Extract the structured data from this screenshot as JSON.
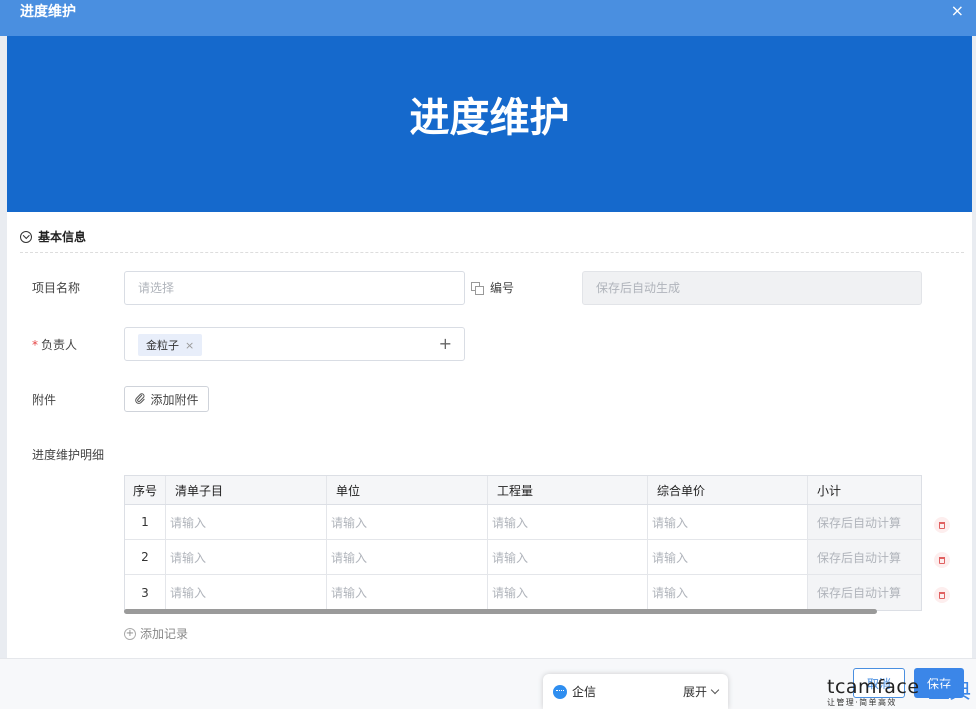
{
  "window": {
    "title": "进度维护",
    "close_icon": "×"
  },
  "banner": {
    "title": "进度维护"
  },
  "section": {
    "title": "基本信息"
  },
  "form": {
    "project_name": {
      "label": "项目名称",
      "placeholder": "请选择"
    },
    "code": {
      "label": "编号",
      "placeholder": "保存后自动生成"
    },
    "owner": {
      "required_mark": "*",
      "label": "负责人",
      "tag": "金粒子",
      "tag_remove": "×",
      "add": "+"
    },
    "attachment": {
      "label": "附件",
      "button": "添加附件"
    },
    "detail": {
      "label": "进度维护明细"
    }
  },
  "table": {
    "columns": [
      "序号",
      "清单子目",
      "单位",
      "工程量",
      "综合单价",
      "小计"
    ],
    "rows": [
      {
        "index": "1",
        "item": "请输入",
        "unit": "请输入",
        "quantity": "请输入",
        "price": "请输入",
        "subtotal": "保存后自动计算"
      },
      {
        "index": "2",
        "item": "请输入",
        "unit": "请输入",
        "quantity": "请输入",
        "price": "请输入",
        "subtotal": "保存后自动计算"
      },
      {
        "index": "3",
        "item": "请输入",
        "unit": "请输入",
        "quantity": "请输入",
        "price": "请输入",
        "subtotal": "保存后自动计算"
      }
    ],
    "add_record": "添加记录"
  },
  "footer": {
    "cancel": "取消",
    "save": "保存"
  },
  "chat": {
    "name": "企信",
    "expand": "展开"
  },
  "watermark": {
    "brand_en": "tcamface",
    "brand_cn": "正典",
    "slogan": "让管理·简单高效"
  },
  "colors": {
    "titlebar": "#4a8fe0",
    "banner": "#1569cc",
    "primary": "#3b86e8",
    "danger": "#e54545"
  }
}
